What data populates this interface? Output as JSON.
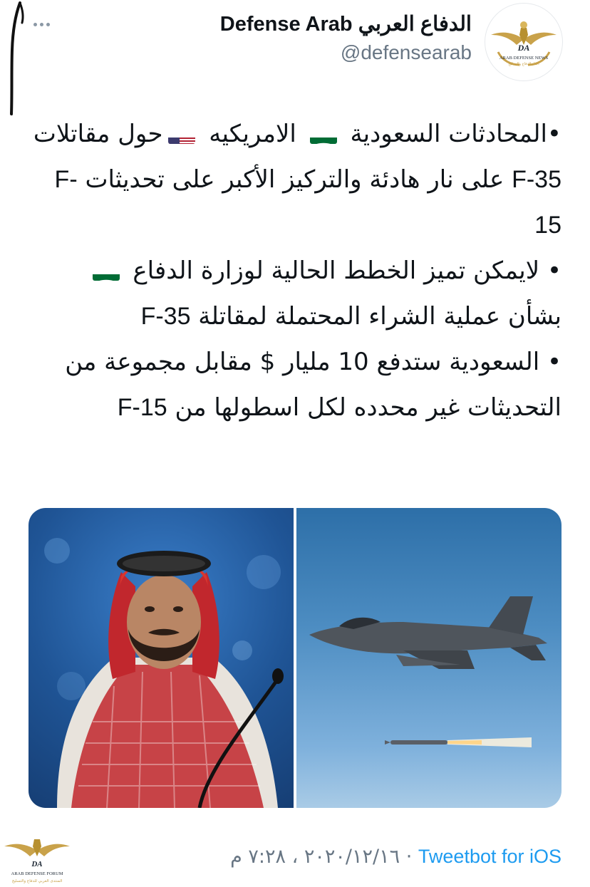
{
  "tweet": {
    "display_name": "Defense Arab الدفاع العربي",
    "handle": "@defensearab",
    "paragraphs": [
      {
        "parts": [
          {
            "text": "•المحادثات السعودية "
          },
          {
            "flag": "saudi"
          },
          {
            "text": " الامريكيه "
          },
          {
            "flag": "usa"
          },
          {
            "text": "حول مقاتلات "
          },
          {
            "text": "F-35",
            "ltr": true
          },
          {
            "text": " على نار هادئة والتركيز الأكبر على تحديثات "
          },
          {
            "text": "F-15",
            "ltr": true
          }
        ]
      },
      {
        "parts": [
          {
            "text": "• لايمكن تميز الخطط الحالية لوزارة الدفاع "
          },
          {
            "flag": "saudi"
          },
          {
            "text": " بشأن عملية الشراء المحتملة لمقاتلة "
          },
          {
            "text": "F-35",
            "ltr": true
          }
        ]
      },
      {
        "parts": [
          {
            "text": "• السعودية ستدفع 10 مليار $ مقابل مجموعة من التحديثات غير محدده لكل اسطولها من "
          },
          {
            "text": "F-15",
            "ltr": true
          }
        ]
      }
    ],
    "timestamp": "٢٠٢٠/١٢/١٦ ، ٧:٢٨ م",
    "separator": "·",
    "source_app": "Tweetbot for iOS"
  },
  "avatar_logo": {
    "monogram": "DA",
    "caption": "ARAB DEFENSE NEWS",
    "caption_ar": "أخبار الدفاع والتسليح"
  },
  "watermark_logo": {
    "monogram": "DA",
    "caption": "ARAB DEFENSE FORUM",
    "caption_ar": "المنتدى العربي للدفاع والتسليح"
  },
  "media": {
    "left_image": "f35-jet-firing-missile",
    "right_image": "man-in-red-keffiyeh-at-microphone"
  },
  "colors": {
    "link": "#1d9bf0",
    "secondary_text": "#687684",
    "gold": "#c9a24a"
  }
}
